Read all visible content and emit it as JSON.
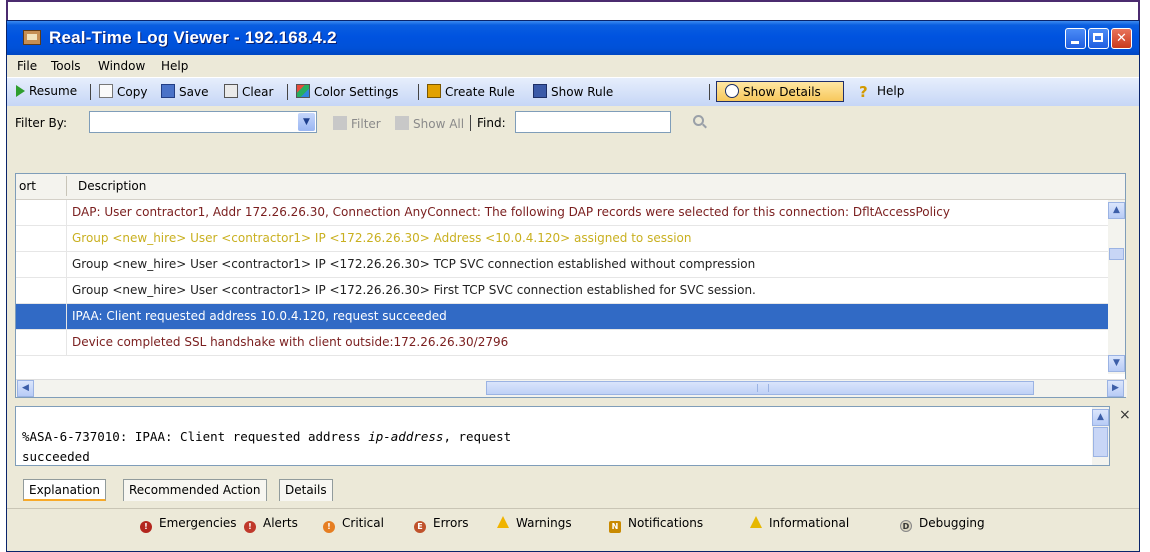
{
  "window": {
    "title": "Real-Time Log Viewer - 192.168.4.2"
  },
  "menu": [
    "File",
    "Tools",
    "Window",
    "Help"
  ],
  "toolbar": {
    "resume": "Resume",
    "copy": "Copy",
    "save": "Save",
    "clear": "Clear",
    "color_settings": "Color Settings",
    "create_rule": "Create Rule",
    "show_rule": "Show Rule",
    "show_details": "Show Details",
    "help": "Help"
  },
  "filter": {
    "label": "Filter By:",
    "value": "",
    "filter_button": "Filter",
    "show_all_button": "Show All",
    "find_label": "Find:",
    "find_value": ""
  },
  "table": {
    "columns": [
      "ort",
      "Description"
    ],
    "rows": [
      {
        "description": "DAP: User contractor1, Addr 172.26.26.30, Connection AnyConnect: The following DAP records were selected for this connection: DfltAccessPolicy",
        "color": "#7a1e1e",
        "selected": false
      },
      {
        "description": "Group <new_hire> User <contractor1> IP <172.26.26.30> Address <10.0.4.120> assigned to session",
        "color": "#c9b020",
        "selected": false
      },
      {
        "description": "Group <new_hire> User <contractor1> IP <172.26.26.30> TCP SVC connection established without compression",
        "color": "#222222",
        "selected": false
      },
      {
        "description": "Group <new_hire> User <contractor1> IP <172.26.26.30> First TCP SVC connection established for SVC session.",
        "color": "#222222",
        "selected": false
      },
      {
        "description": "IPAA: Client requested address 10.0.4.120, request succeeded",
        "color": "#ffffff",
        "selected": true
      },
      {
        "description": "Device completed SSL handshake with client outside:172.26.26.30/2796",
        "color": "#7a1e1e",
        "selected": false
      }
    ]
  },
  "details": {
    "line1_prefix": "%ASA-6-737010: IPAA: Client requested address ",
    "line1_italic": "ip-address",
    "line1_suffix": ", request",
    "line2": "succeeded",
    "close": "×"
  },
  "tabs": [
    "Explanation",
    "Recommended Action",
    "Details"
  ],
  "legend": [
    {
      "label": "Emergencies",
      "color": "#b3261e",
      "icon": "emergency-icon"
    },
    {
      "label": "Alerts",
      "color": "#c0392b",
      "icon": "alert-icon"
    },
    {
      "label": "Critical",
      "color": "#e67e22",
      "icon": "critical-icon"
    },
    {
      "label": "Errors",
      "color": "#c0522b",
      "icon": "error-icon"
    },
    {
      "label": "Warnings",
      "color": "#f0b400",
      "icon": "warning-icon"
    },
    {
      "label": "Notifications",
      "color": "#c98a00",
      "icon": "notification-icon"
    },
    {
      "label": "Informational",
      "color": "#e6b800",
      "icon": "informational-icon"
    },
    {
      "label": "Debugging",
      "color": "#d9d4c0",
      "icon": "debugging-icon"
    }
  ]
}
